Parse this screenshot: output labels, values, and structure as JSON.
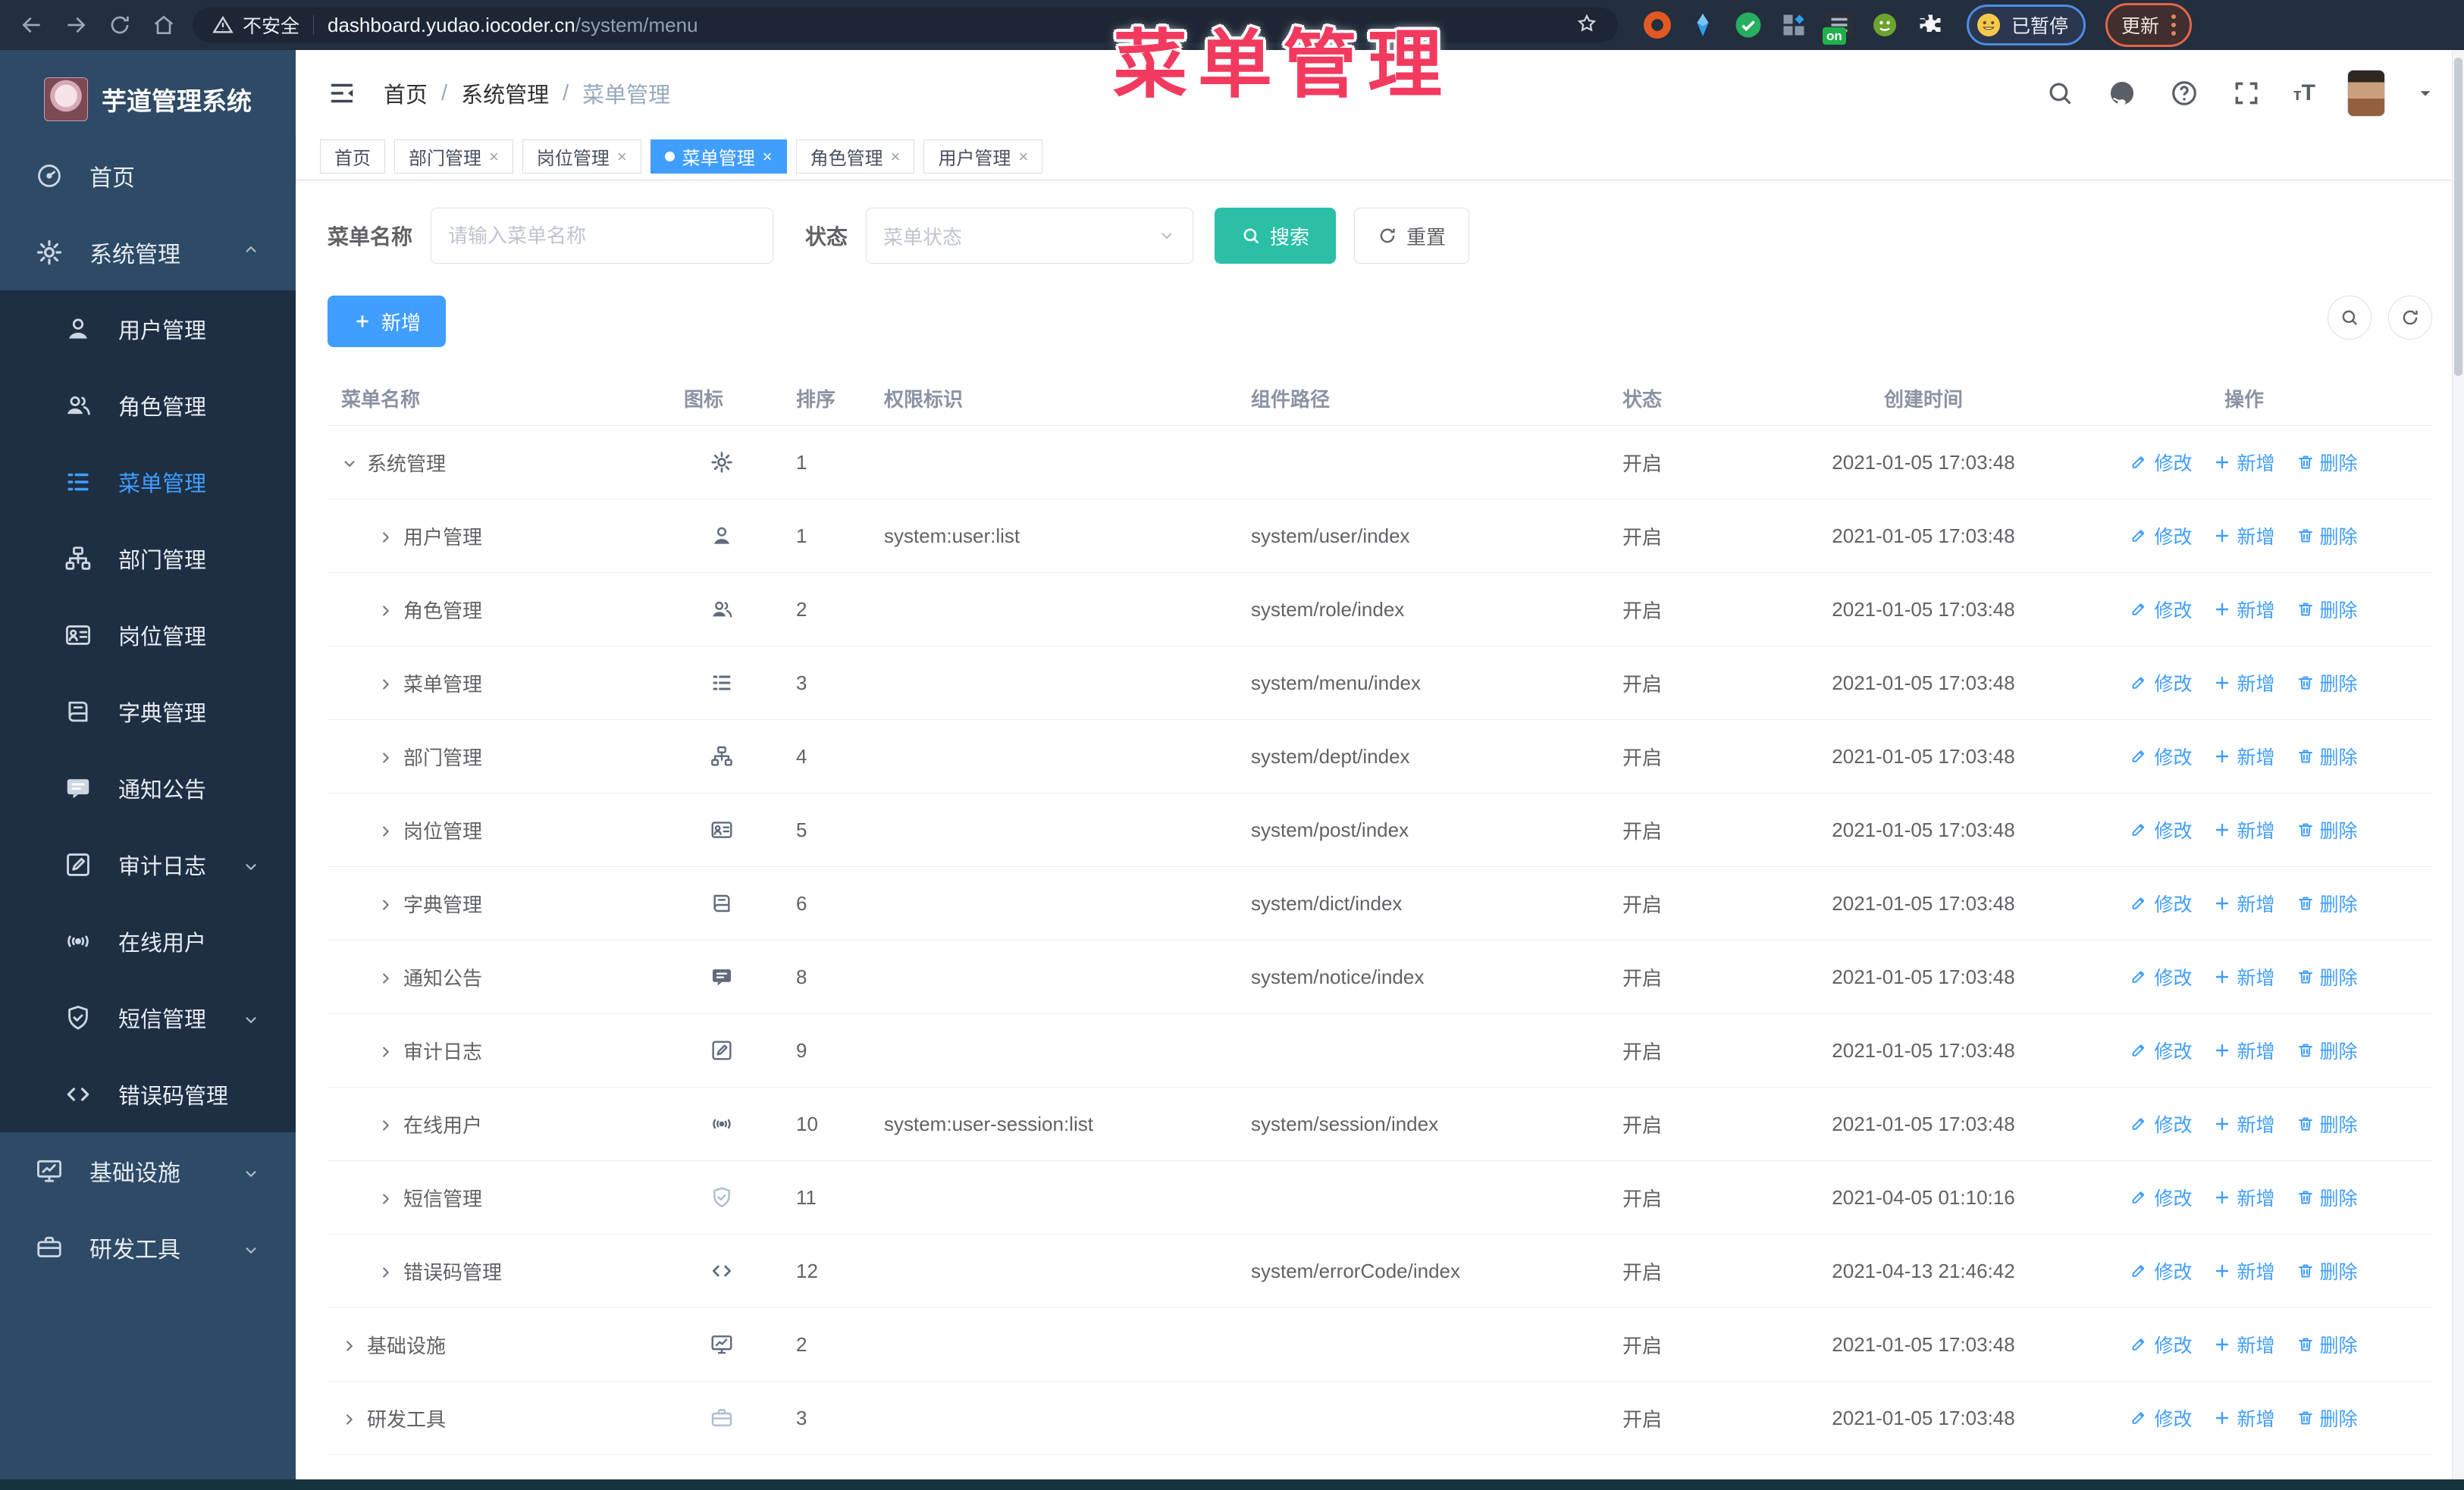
{
  "browser": {
    "security_label": "不安全",
    "url_host": "dashboard.yudao.iocoder.cn",
    "url_path": "/system/menu",
    "paused_badge": "已暂停",
    "update_button": "更新",
    "on_badge": "on",
    "extensions": [
      {
        "name": "ext-orange-ring-icon",
        "color": "#e25822",
        "shape": "ring"
      },
      {
        "name": "ext-blue-kite-icon",
        "color": "#2e9df0",
        "shape": "kite"
      },
      {
        "name": "ext-green-check-icon",
        "color": "#27ae60",
        "shape": "check"
      },
      {
        "name": "ext-grid-icon",
        "color": "#3d4a5c",
        "shape": "grid"
      },
      {
        "name": "ext-tasks-on-icon",
        "color": "#2b2f36",
        "shape": "on"
      },
      {
        "name": "ext-green-bot-icon",
        "color": "#6ca32e",
        "shape": "bot"
      },
      {
        "name": "ext-puzzle-icon",
        "color": "#f2f4f6",
        "shape": "puzzle"
      }
    ]
  },
  "overlay": {
    "title": "菜单管理",
    "color": "#f23a5f"
  },
  "sidebar": {
    "logo_title": "芋道管理系统",
    "items": [
      {
        "label": "首页",
        "icon": "dashboard-icon",
        "type": "top"
      },
      {
        "label": "系统管理",
        "icon": "gear-icon",
        "type": "top",
        "caret": "up"
      },
      {
        "label": "用户管理",
        "icon": "user-icon",
        "type": "sub"
      },
      {
        "label": "角色管理",
        "icon": "users-icon",
        "type": "sub"
      },
      {
        "label": "菜单管理",
        "icon": "menu-icon",
        "type": "sub",
        "active": true
      },
      {
        "label": "部门管理",
        "icon": "tree-icon",
        "type": "sub"
      },
      {
        "label": "岗位管理",
        "icon": "idcard-icon",
        "type": "sub"
      },
      {
        "label": "字典管理",
        "icon": "dict-icon",
        "type": "sub"
      },
      {
        "label": "通知公告",
        "icon": "message-icon",
        "type": "sub"
      },
      {
        "label": "审计日志",
        "icon": "edit-icon",
        "type": "sub",
        "caret": "down"
      },
      {
        "label": "在线用户",
        "icon": "online-icon",
        "type": "sub"
      },
      {
        "label": "短信管理",
        "icon": "shield-icon",
        "type": "sub",
        "caret": "down"
      },
      {
        "label": "错误码管理",
        "icon": "code-icon",
        "type": "sub"
      },
      {
        "label": "基础设施",
        "icon": "monitor-icon",
        "type": "top",
        "caret": "down"
      },
      {
        "label": "研发工具",
        "icon": "toolbox-icon",
        "type": "top",
        "caret": "down"
      }
    ]
  },
  "header": {
    "breadcrumb": [
      "首页",
      "系统管理",
      "菜单管理"
    ]
  },
  "tabs": [
    {
      "label": "首页",
      "closable": false,
      "active": false
    },
    {
      "label": "部门管理",
      "closable": true,
      "active": false
    },
    {
      "label": "岗位管理",
      "closable": true,
      "active": false
    },
    {
      "label": "菜单管理",
      "closable": true,
      "active": true
    },
    {
      "label": "角色管理",
      "closable": true,
      "active": false
    },
    {
      "label": "用户管理",
      "closable": true,
      "active": false
    }
  ],
  "filters": {
    "name_label": "菜单名称",
    "name_placeholder": "请输入菜单名称",
    "name_value": "",
    "status_label": "状态",
    "status_placeholder": "菜单状态",
    "search_label": "搜索",
    "reset_label": "重置"
  },
  "toolbar": {
    "add_label": "新增"
  },
  "table": {
    "columns": [
      "菜单名称",
      "图标",
      "排序",
      "权限标识",
      "组件路径",
      "状态",
      "创建时间",
      "操作"
    ],
    "row_actions": [
      "修改",
      "新增",
      "删除"
    ],
    "rows": [
      {
        "name": "系统管理",
        "level": 0,
        "expand": "down",
        "icon": "gear-icon",
        "sort": "1",
        "perm": "",
        "path": "",
        "status": "开启",
        "time": "2021-01-05 17:03:48"
      },
      {
        "name": "用户管理",
        "level": 1,
        "expand": "right",
        "icon": "user-icon",
        "sort": "1",
        "perm": "system:user:list",
        "path": "system/user/index",
        "status": "开启",
        "time": "2021-01-05 17:03:48"
      },
      {
        "name": "角色管理",
        "level": 1,
        "expand": "right",
        "icon": "users-icon",
        "sort": "2",
        "perm": "",
        "path": "system/role/index",
        "status": "开启",
        "time": "2021-01-05 17:03:48"
      },
      {
        "name": "菜单管理",
        "level": 1,
        "expand": "right",
        "icon": "menu-icon",
        "sort": "3",
        "perm": "",
        "path": "system/menu/index",
        "status": "开启",
        "time": "2021-01-05 17:03:48"
      },
      {
        "name": "部门管理",
        "level": 1,
        "expand": "right",
        "icon": "tree-icon",
        "sort": "4",
        "perm": "",
        "path": "system/dept/index",
        "status": "开启",
        "time": "2021-01-05 17:03:48"
      },
      {
        "name": "岗位管理",
        "level": 1,
        "expand": "right",
        "icon": "idcard-icon",
        "sort": "5",
        "perm": "",
        "path": "system/post/index",
        "status": "开启",
        "time": "2021-01-05 17:03:48"
      },
      {
        "name": "字典管理",
        "level": 1,
        "expand": "right",
        "icon": "dict-icon",
        "sort": "6",
        "perm": "",
        "path": "system/dict/index",
        "status": "开启",
        "time": "2021-01-05 17:03:48"
      },
      {
        "name": "通知公告",
        "level": 1,
        "expand": "right",
        "icon": "message-icon",
        "sort": "8",
        "perm": "",
        "path": "system/notice/index",
        "status": "开启",
        "time": "2021-01-05 17:03:48"
      },
      {
        "name": "审计日志",
        "level": 1,
        "expand": "right",
        "icon": "edit-icon",
        "sort": "9",
        "perm": "",
        "path": "",
        "status": "开启",
        "time": "2021-01-05 17:03:48"
      },
      {
        "name": "在线用户",
        "level": 1,
        "expand": "right",
        "icon": "online-icon",
        "sort": "10",
        "perm": "system:user-session:list",
        "path": "system/session/index",
        "status": "开启",
        "time": "2021-01-05 17:03:48"
      },
      {
        "name": "短信管理",
        "level": 1,
        "expand": "right",
        "icon": "shield-icon",
        "muted": true,
        "sort": "11",
        "perm": "",
        "path": "",
        "status": "开启",
        "time": "2021-04-05 01:10:16"
      },
      {
        "name": "错误码管理",
        "level": 1,
        "expand": "right",
        "icon": "code-icon",
        "sort": "12",
        "perm": "",
        "path": "system/errorCode/index",
        "status": "开启",
        "time": "2021-04-13 21:46:42"
      },
      {
        "name": "基础设施",
        "level": 0,
        "expand": "right",
        "icon": "monitor-icon",
        "sort": "2",
        "perm": "",
        "path": "",
        "status": "开启",
        "time": "2021-01-05 17:03:48"
      },
      {
        "name": "研发工具",
        "level": 0,
        "expand": "right",
        "icon": "toolbox-icon",
        "muted": true,
        "sort": "3",
        "perm": "",
        "path": "",
        "status": "开启",
        "time": "2021-01-05 17:03:48"
      }
    ]
  },
  "colors": {
    "primary": "#409EFF",
    "search_teal": "#2bbfa7",
    "overlay_red": "#f23a5f",
    "sidebar_bg": "#2d4a67",
    "submenu_bg": "#1e2f44",
    "chrome_bg": "#232e3e",
    "breadcrumb_muted": "#97a8be",
    "status_text": "#606266"
  }
}
